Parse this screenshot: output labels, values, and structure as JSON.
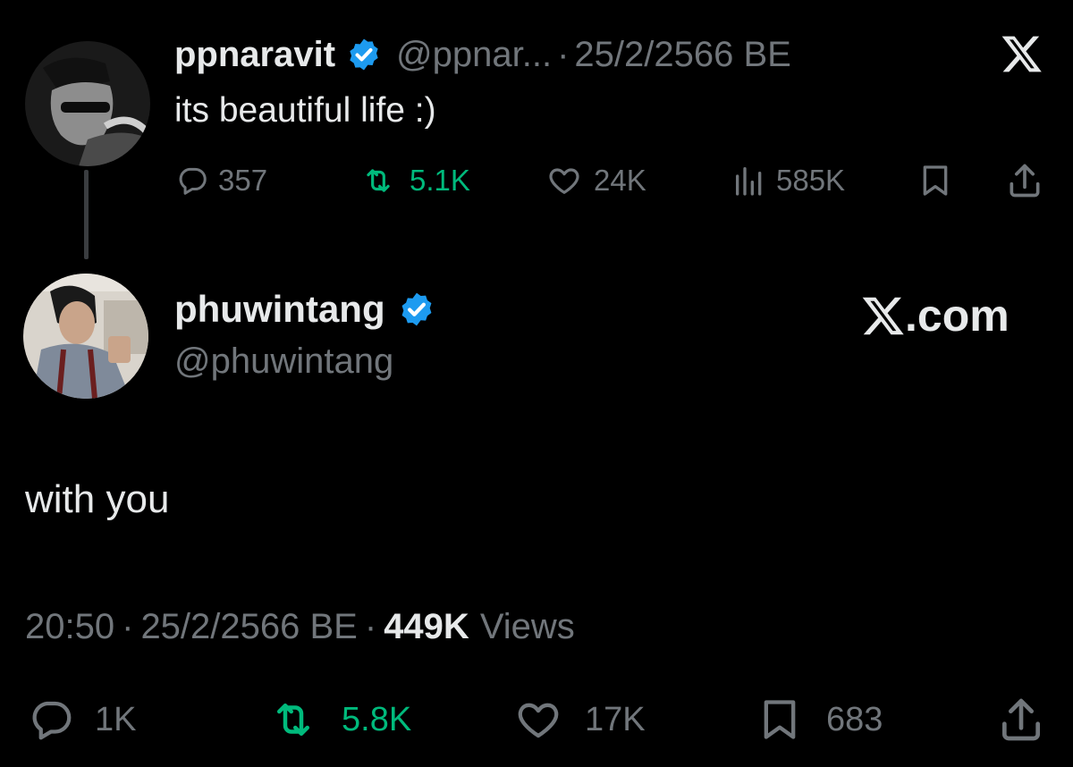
{
  "quoted_tweet": {
    "display_name": "ppnaravit",
    "handle": "@ppnar...",
    "separator": "·",
    "date": "25/2/2566 BE",
    "text": "its beautiful life :)",
    "actions": {
      "replies": "357",
      "reposts": "5.1K",
      "likes": "24K",
      "views": "585K"
    }
  },
  "main_tweet": {
    "display_name": "phuwintang",
    "handle": "@phuwintang",
    "brand": "X.com",
    "text": "with you",
    "time": "20:50",
    "sep1": "·",
    "date": "25/2/2566 BE",
    "sep2": "·",
    "views_count": "449K",
    "views_label": "Views",
    "actions": {
      "replies": "1K",
      "reposts": "5.8K",
      "likes": "17K",
      "bookmarks": "683"
    }
  },
  "colors": {
    "background": "#000000",
    "text": "#e7e9ea",
    "muted": "#71767b",
    "repost_active": "#00ba7c",
    "verified": "#1d9bf0"
  },
  "icons": [
    "reply-icon",
    "repost-icon",
    "like-icon",
    "views-icon",
    "bookmark-icon",
    "share-icon",
    "verified-badge-icon",
    "x-logo-icon"
  ]
}
